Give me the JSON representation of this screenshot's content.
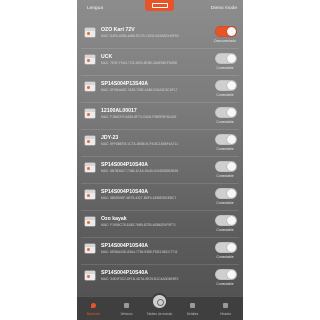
{
  "header": {
    "language_label": "Lengua",
    "demo_label": "Demo mode"
  },
  "devices": [
    {
      "name": "OZO Kart 72V",
      "mac": "MAC: 84FA-8088-4A86-ED75-C6ED-B49A8FA49F63",
      "status": "Desconectado",
      "connected": true
    },
    {
      "name": "UCK",
      "mac": "MAC: 7E5F-F0A3-7C5-3893-5E5B-3A8E8B1FD85D",
      "status": "Conectable",
      "connected": false
    },
    {
      "name": "SP14S004P13S40A",
      "mac": "MAC: 8F0B4A8D-7A35-7085-4A86-E62A3D5C6F17",
      "status": "Conectable",
      "connected": false
    },
    {
      "name": "12100AL00017",
      "mac": "MAC: F1B8CF9-5A59-8F70-C6D5-F9BBF8FAD426",
      "status": "Conectable",
      "connected": false
    },
    {
      "name": "JDY-23",
      "mac": "MAC: 5FF8BEE8-1C7A-4B58-9CF5-8C1E86F4A711",
      "status": "Conectable",
      "connected": false
    },
    {
      "name": "SP14S004P10S40A",
      "mac": "MAC: 8B7B3A07-7466-4C4A-9A4D-6243EBDB3B35",
      "status": "Conectable",
      "connected": false
    },
    {
      "name": "SP14S004P10S40A",
      "mac": "MAC: 5B05949F-6B75-4327-B8F4-1898E952EBC7",
      "status": "Conectable",
      "connected": false
    },
    {
      "name": "Ozo kayak",
      "mac": "MAC: F1906C78-5185-76B9-872B-4BB6291F9F71",
      "status": "Conectable",
      "connected": false
    },
    {
      "name": "SP14S004P10S40A",
      "mac": "MAC: 6E56A43D-83A4-7736-9389-F5D3-58CC7711",
      "status": "Conectable",
      "connected": false
    },
    {
      "name": "SP14S004P10S40A",
      "mac": "MAC: 34E4F3C2-8F1B-4D7A-9E25-B1C4A0D6E8F2",
      "status": "Conectable",
      "connected": false
    }
  ],
  "nav": {
    "tabs": [
      {
        "label": "Bluetooth",
        "icon": "location-pin-icon",
        "active": true
      },
      {
        "label": "Vehiculo",
        "icon": "battery-icon",
        "active": false
      },
      {
        "label": "Tablero de mando",
        "icon": "dashboard-icon",
        "active": false
      },
      {
        "label": "Detalles",
        "icon": "details-icon",
        "active": false
      },
      {
        "label": "Historia",
        "icon": "history-icon",
        "active": false
      }
    ]
  },
  "colors": {
    "accent": "#e8542a",
    "background_top": "#8d8d8d",
    "background_bottom": "#4f4f4f",
    "nav_bg": "#3f3f3f"
  }
}
